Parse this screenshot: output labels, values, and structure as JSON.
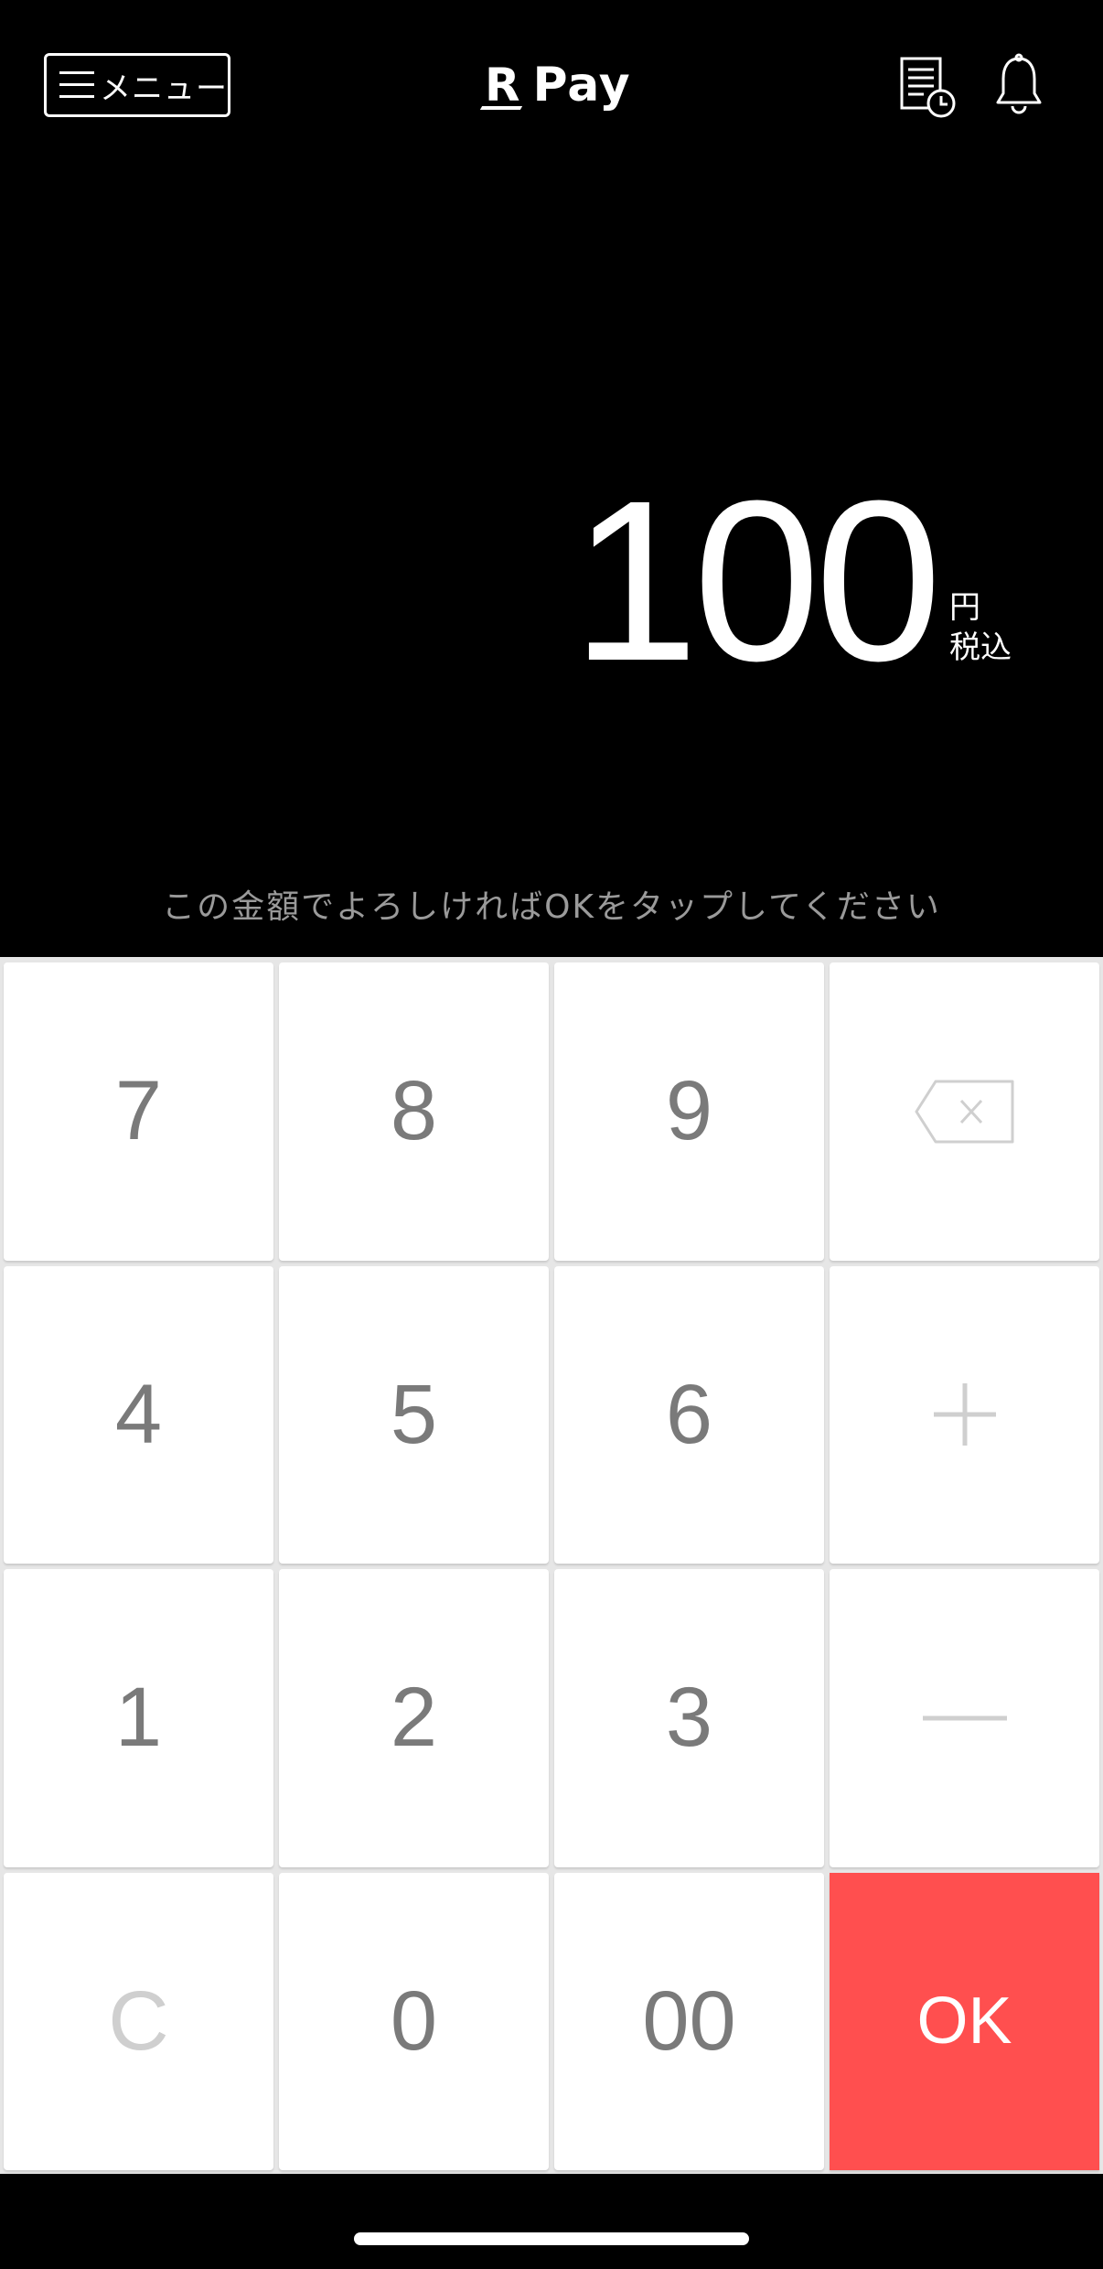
{
  "header": {
    "menu_label": "メニュー",
    "logo_r": "R",
    "logo_pay": "Pay"
  },
  "amount": {
    "value": "100",
    "currency": "円",
    "tax_note": "税込"
  },
  "instruction": "この金額でよろしければOKをタップしてください",
  "keypad": {
    "k7": "7",
    "k8": "8",
    "k9": "9",
    "k4": "4",
    "k5": "5",
    "k6": "6",
    "k1": "1",
    "k2": "2",
    "k3": "3",
    "kc": "C",
    "k0": "0",
    "k00": "00",
    "ok": "OK"
  },
  "colors": {
    "background": "#000000",
    "ok_button": "#ff4f4f",
    "key_text": "#7a7a7a",
    "key_muted": "#cfcfcf"
  },
  "icons": [
    "menu-icon",
    "history-icon",
    "bell-icon",
    "backspace-icon",
    "plus-icon",
    "minus-icon"
  ]
}
